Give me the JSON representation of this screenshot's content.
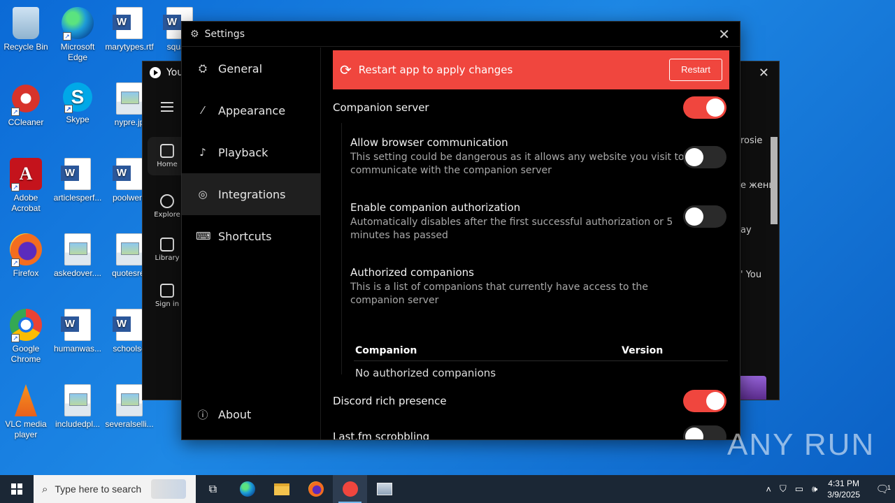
{
  "desktop": {
    "icons": [
      {
        "label": "Recycle Bin"
      },
      {
        "label": "Microsoft Edge"
      },
      {
        "label": "marytypes.rtf"
      },
      {
        "label": "square"
      },
      {
        "label": "CCleaner"
      },
      {
        "label": "Skype"
      },
      {
        "label": "nypre.jp"
      },
      {
        "label": "Adobe Acrobat"
      },
      {
        "label": "articlesperf..."
      },
      {
        "label": "poolwent"
      },
      {
        "label": "Firefox"
      },
      {
        "label": "askedover...."
      },
      {
        "label": "quotesret"
      },
      {
        "label": "Google Chrome"
      },
      {
        "label": "humanwas..."
      },
      {
        "label": "schoolse"
      },
      {
        "label": "VLC media player"
      },
      {
        "label": "includedpl..."
      },
      {
        "label": "severalselli..."
      }
    ]
  },
  "ytm": {
    "title": "You",
    "nav": [
      {
        "label": "Home"
      },
      {
        "label": "Explore"
      },
      {
        "label": "Library"
      },
      {
        "label": "Sign in"
      }
    ],
    "peek": [
      "rosie",
      "е женщ",
      "ay",
      "' You"
    ]
  },
  "settings": {
    "title": "Settings",
    "sidebar": [
      {
        "label": "General",
        "icon": "general-icon"
      },
      {
        "label": "Appearance",
        "icon": "brush-icon"
      },
      {
        "label": "Playback",
        "icon": "music-note-icon"
      },
      {
        "label": "Integrations",
        "icon": "integrations-icon"
      },
      {
        "label": "Shortcuts",
        "icon": "keyboard-icon"
      }
    ],
    "about_label": "About",
    "banner": {
      "text": "Restart app to apply changes",
      "button": "Restart"
    },
    "companion_server": {
      "label": "Companion server",
      "on": true
    },
    "allow_browser": {
      "label": "Allow browser communication",
      "desc": "This setting could be dangerous as it allows any website you visit to communicate with the companion server",
      "on": false
    },
    "companion_auth": {
      "label": "Enable companion authorization",
      "desc": "Automatically disables after the first successful authorization or 5 minutes has passed",
      "on": false
    },
    "authorized": {
      "label": "Authorized companions",
      "desc": "This is a list of companions that currently have access to the companion server",
      "columns": [
        "Companion",
        "Version"
      ],
      "empty": "No authorized companions"
    },
    "discord": {
      "label": "Discord rich presence",
      "on": true
    },
    "lastfm": {
      "label": "Last.fm scrobbling",
      "on": false
    }
  },
  "taskbar": {
    "search_placeholder": "Type here to search",
    "time": "4:31 PM",
    "date": "3/9/2025",
    "notifications": "1"
  },
  "watermark": "ANY RUN",
  "colors": {
    "accent": "#f0463e",
    "desktop": "#0b6ad6",
    "taskbar": "#1b2735"
  }
}
